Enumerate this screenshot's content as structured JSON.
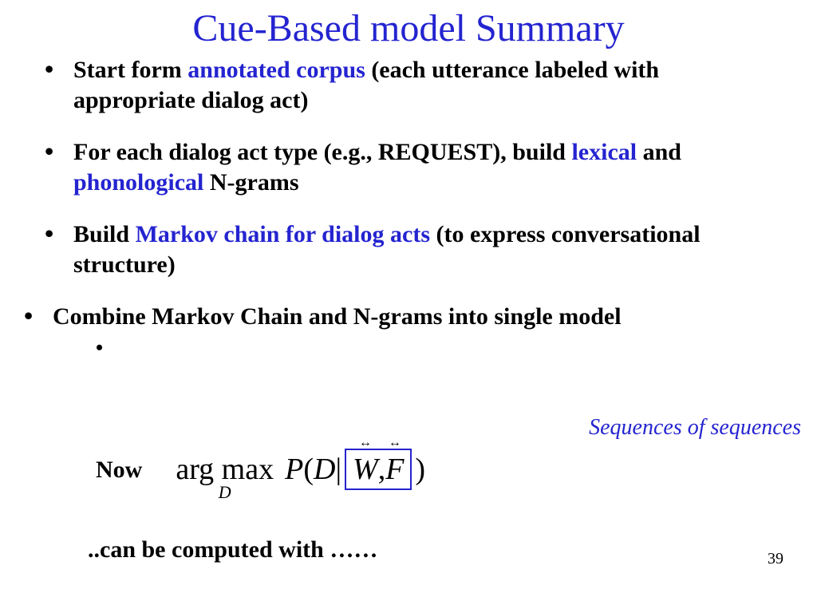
{
  "title": "Cue-Based model Summary",
  "bullets": {
    "b1": {
      "p1": "Start form ",
      "hl1": "annotated corpus",
      "p2": " (each utterance labeled with appropriate dialog act)"
    },
    "b2": {
      "p1": "For each dialog act type (e.g., REQUEST), build ",
      "hl1": "lexical",
      "p2": " and ",
      "hl2": "phonological",
      "p3": " N-grams"
    },
    "b3": {
      "p1": "Build ",
      "hl1": "Markov chain for dialog acts",
      "p2": " (to express conversational structure)"
    },
    "b4": {
      "p1": "Combine Markov Chain and N-grams into single model"
    },
    "sub": {
      "label": "Now"
    }
  },
  "annotation": "Sequences of sequences",
  "formula": {
    "argmax_top": "arg max",
    "argmax_bottom": "D",
    "lhs": "P",
    "lparen": "(",
    "D": "D",
    "bar": " | ",
    "W": "W",
    "comma": ",",
    "F": "F",
    "rparen": ")"
  },
  "computed": "..can be computed with ……",
  "page_number": "39"
}
